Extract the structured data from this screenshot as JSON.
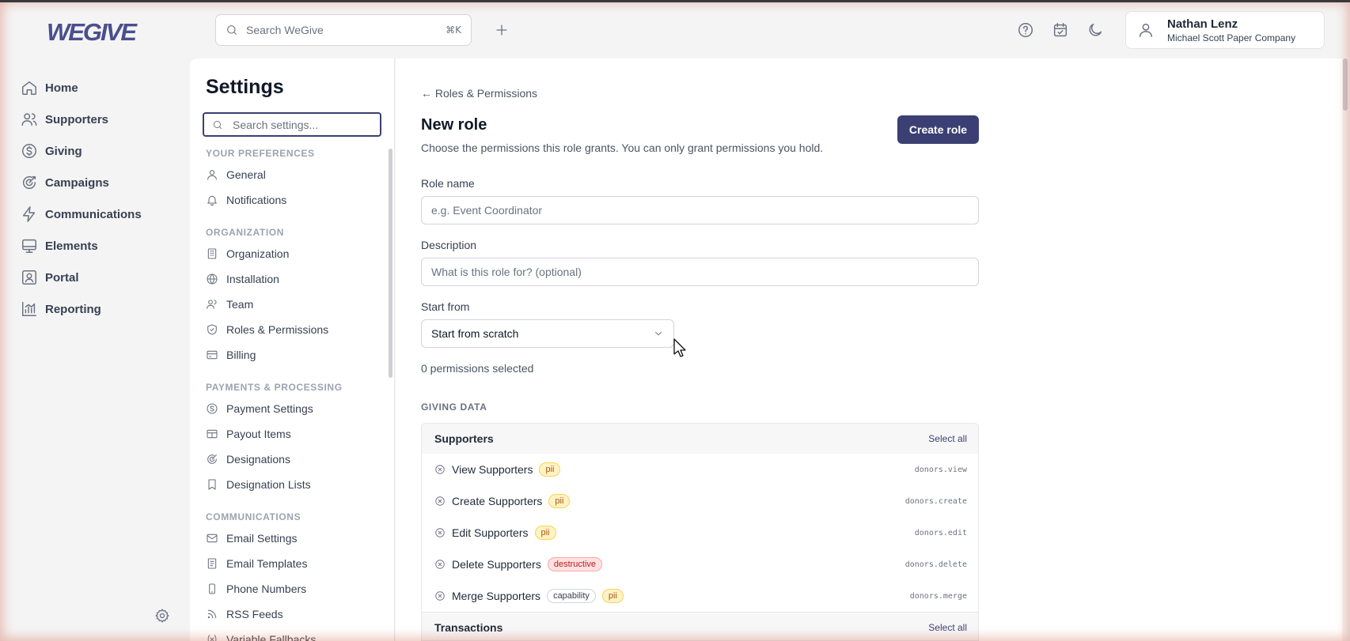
{
  "app": {
    "brand": "WEGIVE"
  },
  "topbar": {
    "search_placeholder": "Search WeGive",
    "search_shortcut": "⌘K",
    "user_name": "Nathan Lenz",
    "user_org": "Michael Scott Paper Company"
  },
  "nav": {
    "items": [
      {
        "label": "Home",
        "icon": "home-icon"
      },
      {
        "label": "Supporters",
        "icon": "users-icon"
      },
      {
        "label": "Giving",
        "icon": "dollar-circle-icon"
      },
      {
        "label": "Campaigns",
        "icon": "campaign-icon"
      },
      {
        "label": "Communications",
        "icon": "bolt-icon"
      },
      {
        "label": "Elements",
        "icon": "monitor-icon"
      },
      {
        "label": "Portal",
        "icon": "portal-icon"
      },
      {
        "label": "Reporting",
        "icon": "chart-icon"
      }
    ]
  },
  "settings": {
    "title": "Settings",
    "search_placeholder": "Search settings...",
    "sections": {
      "prefs": "YOUR PREFERENCES",
      "org": "ORGANIZATION",
      "payments": "PAYMENTS & PROCESSING",
      "comms": "COMMUNICATIONS"
    },
    "items": {
      "general": "General",
      "notifications": "Notifications",
      "organization": "Organization",
      "installation": "Installation",
      "team": "Team",
      "roles": "Roles & Permissions",
      "billing": "Billing",
      "payment_settings": "Payment Settings",
      "payout_items": "Payout Items",
      "designations": "Designations",
      "designation_lists": "Designation Lists",
      "email_settings": "Email Settings",
      "email_templates": "Email Templates",
      "phone_numbers": "Phone Numbers",
      "rss_feeds": "RSS Feeds",
      "variable_fallbacks": "Variable Fallbacks"
    }
  },
  "page": {
    "back_label": "← Roles & Permissions",
    "title": "New role",
    "subtitle": "Choose the permissions this role grants. You can only grant permissions you hold.",
    "create_button": "Create role",
    "role_name_label": "Role name",
    "role_name_placeholder": "e.g. Event Coordinator",
    "role_name_value": "",
    "description_label": "Description",
    "description_placeholder": "What is this role for? (optional)",
    "description_value": "",
    "start_from_label": "Start from",
    "start_from_value": "Start from scratch",
    "selected_count": "0 permissions selected",
    "group_title": "GIVING DATA",
    "select_all_label": "Select all"
  },
  "permissions": {
    "supporters": {
      "title": "Supporters",
      "rows": [
        {
          "name": "View Supporters",
          "badges": [
            "pii"
          ],
          "code": "donors.view"
        },
        {
          "name": "Create Supporters",
          "badges": [
            "pii"
          ],
          "code": "donors.create"
        },
        {
          "name": "Edit Supporters",
          "badges": [
            "pii"
          ],
          "code": "donors.edit"
        },
        {
          "name": "Delete Supporters",
          "badges": [
            "destructive"
          ],
          "code": "donors.delete"
        },
        {
          "name": "Merge Supporters",
          "badges": [
            "capability",
            "pii"
          ],
          "code": "donors.merge"
        }
      ]
    },
    "transactions": {
      "title": "Transactions"
    }
  },
  "colors": {
    "accent": "#3c3f73",
    "brand": "#4a4f8c"
  }
}
